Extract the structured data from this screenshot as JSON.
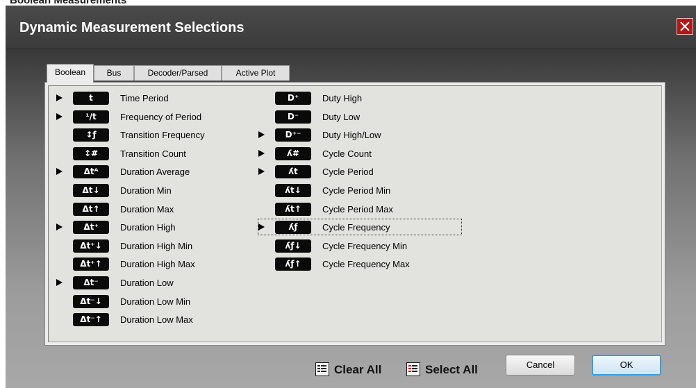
{
  "background": {
    "partial_title": "Boolean Measurements"
  },
  "dialog": {
    "title": "Dynamic Measurement Selections"
  },
  "tabs": [
    {
      "label": "Boolean",
      "active": true
    },
    {
      "label": "Bus",
      "active": false
    },
    {
      "label": "Decoder/Parsed",
      "active": false
    },
    {
      "label": "Active Plot",
      "active": false
    }
  ],
  "measurements": {
    "left": [
      {
        "symbol": "t",
        "label": "Time Period",
        "selected": true
      },
      {
        "symbol": "¹/t",
        "label": "Frequency of Period",
        "selected": true
      },
      {
        "symbol": "↕ƒ",
        "label": "Transition Frequency",
        "selected": false
      },
      {
        "symbol": "↕#",
        "label": "Transition Count",
        "selected": false
      },
      {
        "symbol": "Δtᴬ",
        "label": "Duration Average",
        "selected": true
      },
      {
        "symbol": "Δt↓",
        "label": "Duration Min",
        "selected": false
      },
      {
        "symbol": "Δt↑",
        "label": "Duration Max",
        "selected": false
      },
      {
        "symbol": "Δt⁺",
        "label": "Duration High",
        "selected": true
      },
      {
        "symbol": "Δt⁺↓",
        "label": "Duration High Min",
        "selected": false
      },
      {
        "symbol": "Δt⁺↑",
        "label": "Duration High Max",
        "selected": false
      },
      {
        "symbol": "Δt⁻",
        "label": "Duration Low",
        "selected": true
      },
      {
        "symbol": "Δt⁻↓",
        "label": "Duration Low Min",
        "selected": false
      },
      {
        "symbol": "Δt⁻↑",
        "label": "Duration Low Max",
        "selected": false
      }
    ],
    "right": [
      {
        "symbol": "D⁺",
        "label": "Duty High",
        "selected": false
      },
      {
        "symbol": "D⁻",
        "label": "Duty Low",
        "selected": false
      },
      {
        "symbol": "D⁺⁻",
        "label": "Duty High/Low",
        "selected": true
      },
      {
        "symbol": "ʎ#",
        "label": "Cycle Count",
        "selected": true
      },
      {
        "symbol": "ʎt",
        "label": "Cycle Period",
        "selected": true
      },
      {
        "symbol": "ʎt↓",
        "label": "Cycle Period Min",
        "selected": false
      },
      {
        "symbol": "ʎt↑",
        "label": "Cycle Period Max",
        "selected": false
      },
      {
        "symbol": "ʎƒ",
        "label": "Cycle Frequency",
        "selected": true,
        "focused": true
      },
      {
        "symbol": "ʎƒ↓",
        "label": "Cycle Frequency Min",
        "selected": false
      },
      {
        "symbol": "ʎƒ↑",
        "label": "Cycle Frequency Max",
        "selected": false
      }
    ]
  },
  "footer": {
    "clear_all": "Clear All",
    "select_all": "Select All",
    "cancel": "Cancel",
    "ok": "OK"
  },
  "colors": {
    "accent_ok_border": "#3c9ddc",
    "close_button": "#b01818",
    "badge_bg": "#0a0a0a"
  }
}
